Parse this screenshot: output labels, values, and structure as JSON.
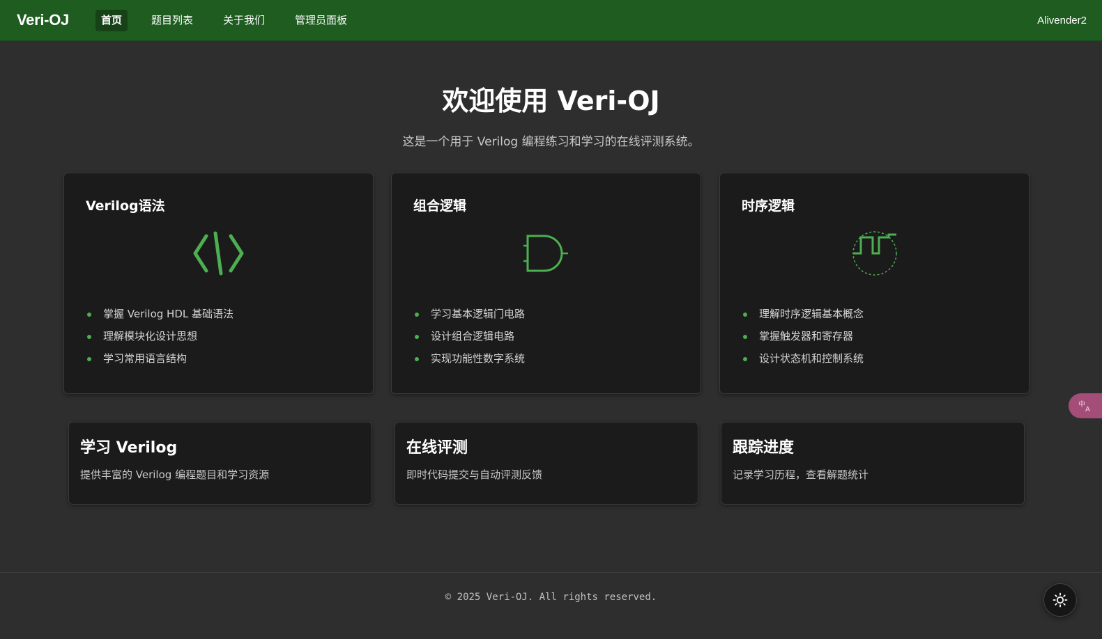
{
  "navbar": {
    "brand": "Veri-OJ",
    "items": [
      {
        "label": "首页",
        "active": true
      },
      {
        "label": "题目列表",
        "active": false
      },
      {
        "label": "关于我们",
        "active": false
      },
      {
        "label": "管理员面板",
        "active": false
      }
    ],
    "user": "Alivender2"
  },
  "hero": {
    "title": "欢迎使用 Veri-OJ",
    "subtitle": "这是一个用于 Verilog 编程练习和学习的在线评测系统。"
  },
  "cards": [
    {
      "title": "Verilog语法",
      "icon": "code-brackets-icon",
      "items": [
        "掌握 Verilog HDL 基础语法",
        "理解模块化设计思想",
        "学习常用语言结构"
      ]
    },
    {
      "title": "组合逻辑",
      "icon": "and-gate-icon",
      "items": [
        "学习基本逻辑门电路",
        "设计组合逻辑电路",
        "实现功能性数字系统"
      ]
    },
    {
      "title": "时序逻辑",
      "icon": "clock-waveform-icon",
      "items": [
        "理解时序逻辑基本概念",
        "掌握触发器和寄存器",
        "设计状态机和控制系统"
      ]
    }
  ],
  "features": [
    {
      "title": "学习 Verilog",
      "desc": "提供丰富的 Verilog 编程题目和学习资源"
    },
    {
      "title": "在线评测",
      "desc": "即时代码提交与自动评测反馈"
    },
    {
      "title": "跟踪进度",
      "desc": "记录学习历程，查看解题统计"
    }
  ],
  "footer": {
    "text": "© 2025 Veri-OJ. All rights reserved."
  },
  "widgets": {
    "theme_icon": "sun-icon",
    "translate_icon": "translate-icon"
  },
  "colors": {
    "navbar": "#1e5c20",
    "accent": "#4caf50",
    "background": "#2e2e2e",
    "card": "#1b1b1b"
  }
}
